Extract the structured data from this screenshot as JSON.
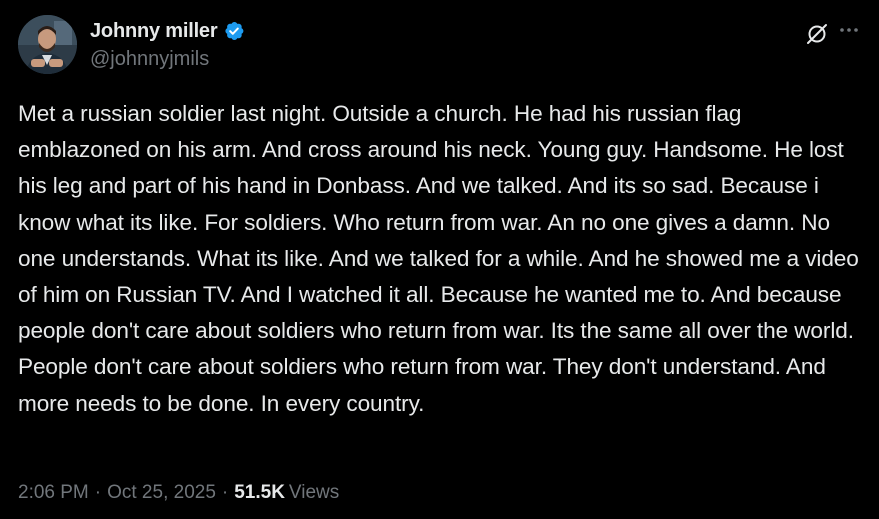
{
  "author": {
    "display_name": "Johnny miller",
    "handle": "@johnnyjmils",
    "verified": true,
    "verified_color": "#1d9bf0"
  },
  "actions": {
    "grok_icon": "grok-slash-circle-icon",
    "more_icon": "ellipsis-icon"
  },
  "tweet": {
    "text": "Met a russian soldier last night. Outside a church. He had his russian flag emblazoned on his arm. And cross around his neck. Young guy. Handsome. He lost his leg and part of his hand in Donbass. And we talked. And its so sad. Because i know what its like. For soldiers. Who return from war. An no one gives a damn. No one understands. What its like. And we talked for a while. And he showed me a video of him on Russian TV. And I watched it all. Because he wanted me to. And because people don't care about soldiers who return from war. Its the same all over the world. People don't care about soldiers who return from war. They don't understand. And more needs to be done. In every country."
  },
  "meta": {
    "time": "2:06 PM",
    "separator": "·",
    "date": "Oct 25, 2025",
    "views_count": "51.5K",
    "views_label": "Views"
  },
  "colors": {
    "background": "#000000",
    "primary_text": "#e7e9ea",
    "secondary_text": "#71767b"
  }
}
